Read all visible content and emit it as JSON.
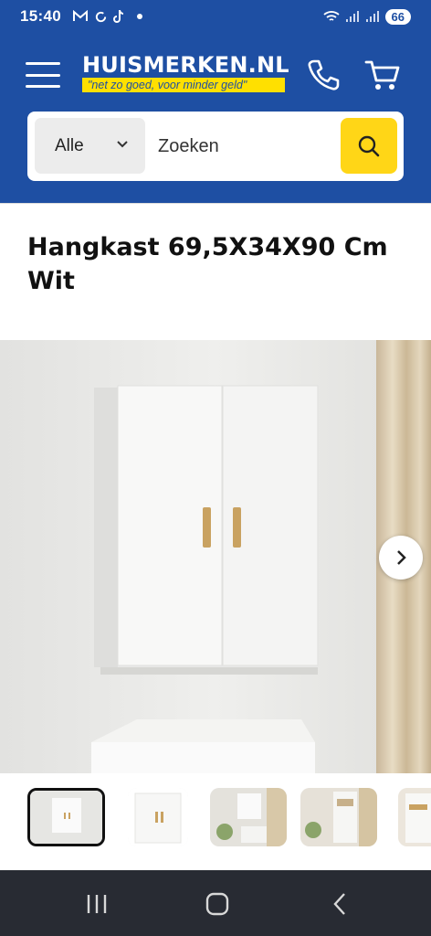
{
  "status_bar": {
    "time": "15:40",
    "battery": "66"
  },
  "header": {
    "logo_title": "HUISMERKEN.NL",
    "logo_tagline": "\"net zo goed, voor minder geld\""
  },
  "search": {
    "category": "Alle",
    "placeholder": "Zoeken"
  },
  "product": {
    "title": "Hangkast 69,5X34X90 Cm Wit"
  },
  "colors": {
    "brand_blue": "#1e4fa3",
    "brand_yellow": "#ffd617"
  }
}
